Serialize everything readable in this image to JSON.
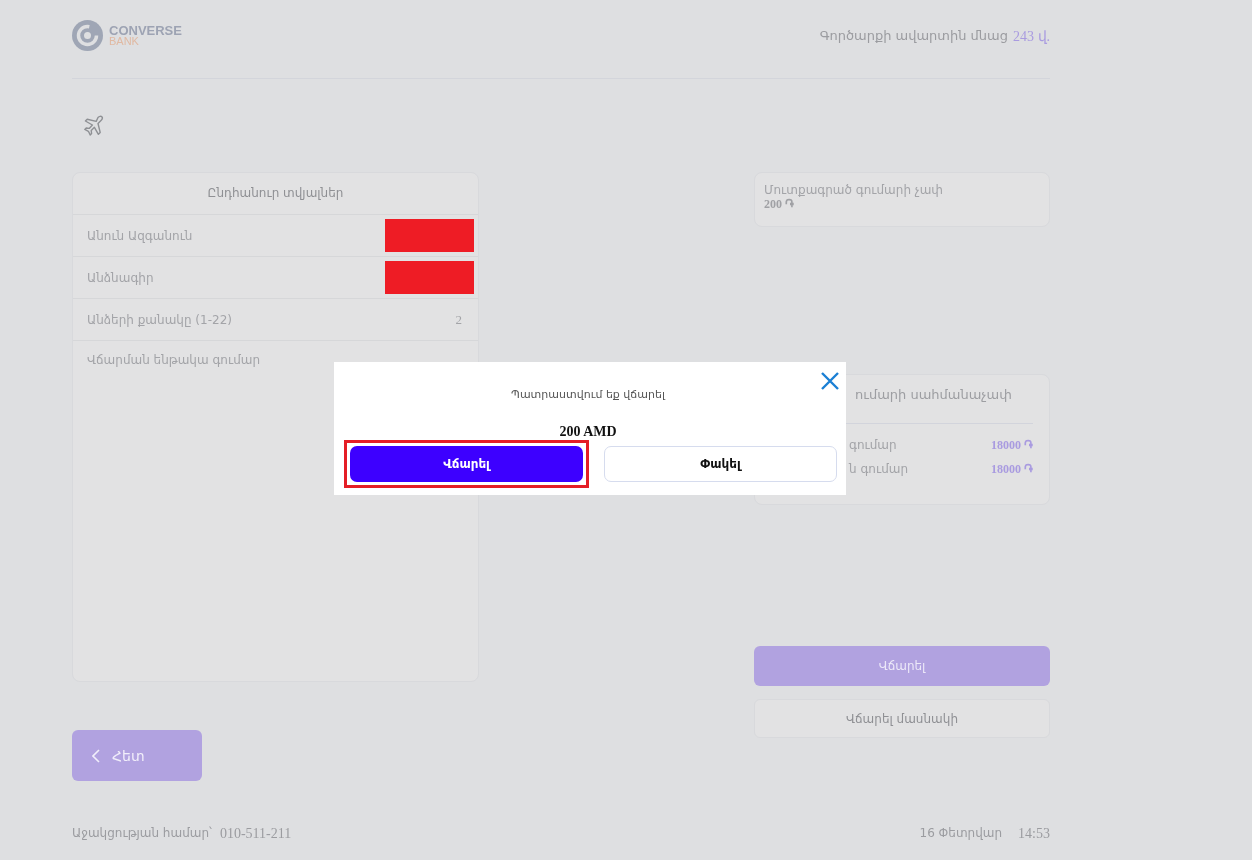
{
  "header": {
    "logo": {
      "name": "CONVERSE",
      "sub": "BANK"
    },
    "timer": {
      "label": "Գործարքի ավարտին մնաց",
      "value": "243 վ."
    }
  },
  "general": {
    "title": "Ընդհանուր տվյալներ",
    "rows": [
      {
        "label": "Անուն Ազգանուն",
        "kind": "redacted"
      },
      {
        "label": "Անձնագիր",
        "kind": "redacted"
      },
      {
        "label": "Անձերի քանակը (1-22)",
        "kind": "value",
        "value": "2"
      },
      {
        "label": "Վճարման ենթակա գումար",
        "kind": "empty"
      }
    ]
  },
  "amount": {
    "label": "Մուտքագրած գումարի չափ",
    "value": "200 ֏"
  },
  "limits": {
    "title": "ումարի սահմանաչափ",
    "rows": [
      {
        "label": "գումար",
        "value": "18000 ֏"
      },
      {
        "label": "ն գումար",
        "value": "18000 ֏"
      }
    ]
  },
  "actions": [
    {
      "label": "Վճարել",
      "kind": "primary"
    },
    {
      "label": "Վճարել մասնակի",
      "kind": "secondary"
    }
  ],
  "back": {
    "label": "Հետ"
  },
  "footer": {
    "help_label": "Աջակցության համար՝",
    "phone": "010-511-211",
    "date": "16 Փետրվար",
    "time": "14:53"
  },
  "modal": {
    "message": "Պատրաստվում եք վճարել",
    "amount": "200 AMD",
    "buttons": [
      {
        "label": "Վճարել",
        "kind": "primary",
        "highlighted": true
      },
      {
        "label": "Փակել",
        "kind": "secondary",
        "highlighted": false
      }
    ]
  }
}
